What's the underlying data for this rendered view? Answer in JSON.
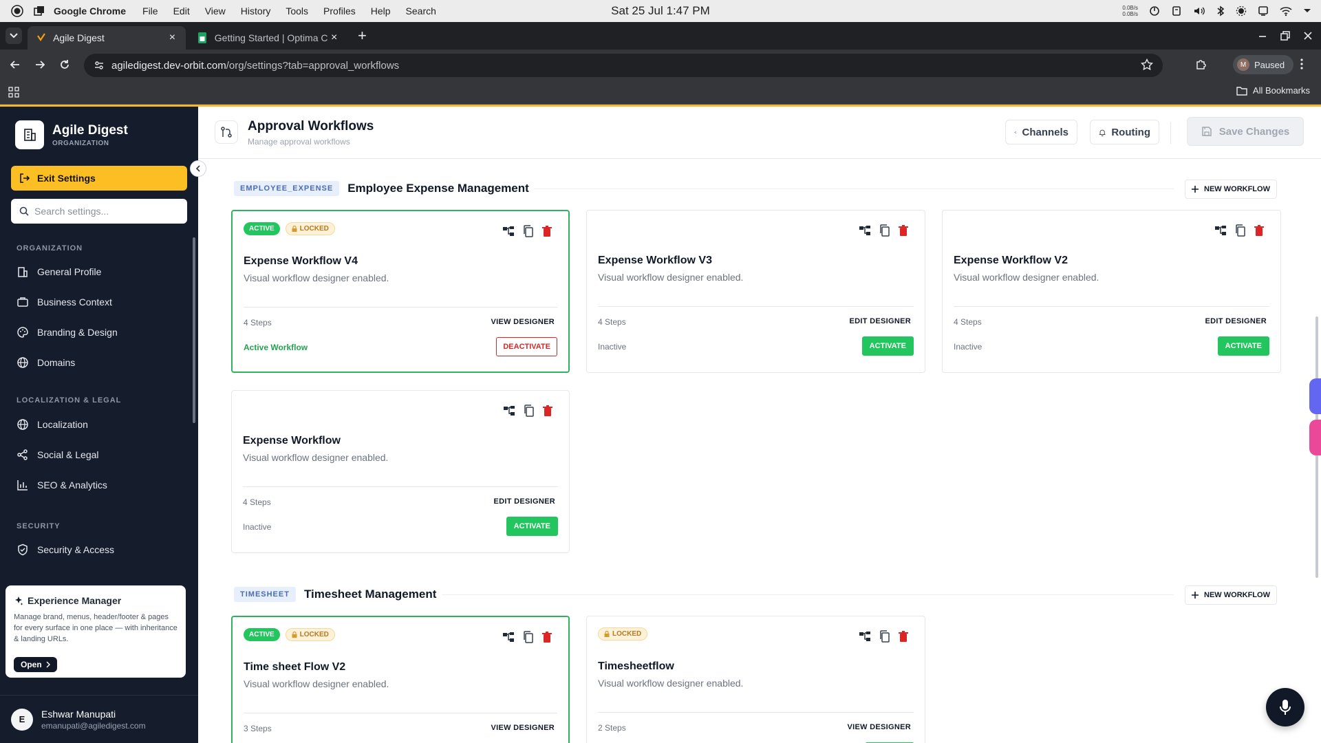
{
  "os_bar": {
    "app_name": "Google Chrome",
    "menu": [
      "File",
      "Edit",
      "View",
      "History",
      "Tools",
      "Profiles",
      "Help",
      "Search"
    ],
    "clock": "Sat 25 Jul  1:47 PM",
    "net_up": "0.0B/s",
    "net_down": "0.0B/s"
  },
  "browser": {
    "tabs": [
      {
        "title": "Agile Digest",
        "active": true
      },
      {
        "title": "Getting Started | Optima C",
        "active": false
      }
    ],
    "url_host": "agiledigest.dev-orbit.com",
    "url_path": "/org/settings?tab=approval_workflows",
    "profile_initial": "M",
    "profile_status": "Paused",
    "all_bookmarks": "All Bookmarks"
  },
  "sidebar": {
    "org_name": "Agile Digest",
    "org_type": "ORGANIZATION",
    "exit_label": "Exit Settings",
    "search_placeholder": "Search settings...",
    "sections": [
      {
        "title": "ORGANIZATION",
        "items": [
          "General Profile",
          "Business Context",
          "Branding & Design",
          "Domains"
        ]
      },
      {
        "title": "LOCALIZATION & LEGAL",
        "items": [
          "Localization",
          "Social & Legal",
          "SEO & Analytics"
        ]
      },
      {
        "title": "SECURITY",
        "items": [
          "Security & Access"
        ]
      }
    ],
    "experience_card": {
      "title": "Experience Manager",
      "description": "Manage brand, menus, header/footer & pages for every surface in one place — with inheritance & landing URLs.",
      "open_label": "Open"
    },
    "user": {
      "initial": "E",
      "name": "Eshwar Manupati",
      "email": "emanupati@agiledigest.com"
    }
  },
  "header": {
    "title": "Approval Workflows",
    "subtitle": "Manage approval workflows",
    "channels_label": "Channels",
    "routing_label": "Routing",
    "save_label": "Save Changes"
  },
  "workflow_sections": [
    {
      "badge": "EMPLOYEE_EXPENSE",
      "title": "Employee Expense Management",
      "new_label": "NEW WORKFLOW",
      "workflows": [
        {
          "name": "Expense Workflow V4",
          "description": "Visual workflow designer enabled.",
          "steps": "4 Steps",
          "designer": "VIEW DESIGNER",
          "status": "Active Workflow",
          "action": "DEACTIVATE",
          "active_badge": "ACTIVE",
          "locked_badge": "LOCKED"
        },
        {
          "name": "Expense Workflow V3",
          "description": "Visual workflow designer enabled.",
          "steps": "4 Steps",
          "designer": "EDIT DESIGNER",
          "status": "Inactive",
          "action": "ACTIVATE"
        },
        {
          "name": "Expense Workflow V2",
          "description": "Visual workflow designer enabled.",
          "steps": "4 Steps",
          "designer": "EDIT DESIGNER",
          "status": "Inactive",
          "action": "ACTIVATE"
        },
        {
          "name": "Expense Workflow",
          "description": "Visual workflow designer enabled.",
          "steps": "4 Steps",
          "designer": "EDIT DESIGNER",
          "status": "Inactive",
          "action": "ACTIVATE"
        }
      ]
    },
    {
      "badge": "TIMESHEET",
      "title": "Timesheet Management",
      "new_label": "NEW WORKFLOW",
      "workflows": [
        {
          "name": "Time sheet Flow V2",
          "description": "Visual workflow designer enabled.",
          "steps": "3 Steps",
          "designer": "VIEW DESIGNER",
          "active_badge": "ACTIVE",
          "locked_badge": "LOCKED"
        },
        {
          "name": "Timesheetflow",
          "description": "Visual workflow designer enabled.",
          "steps": "2 Steps",
          "designer": "VIEW DESIGNER",
          "locked_badge": "LOCKED"
        }
      ]
    }
  ],
  "colors": {
    "accent_yellow": "#fbbf24",
    "sidebar_bg": "#151c2c",
    "active_green": "#22c55e",
    "danger_red": "#dc2626"
  }
}
